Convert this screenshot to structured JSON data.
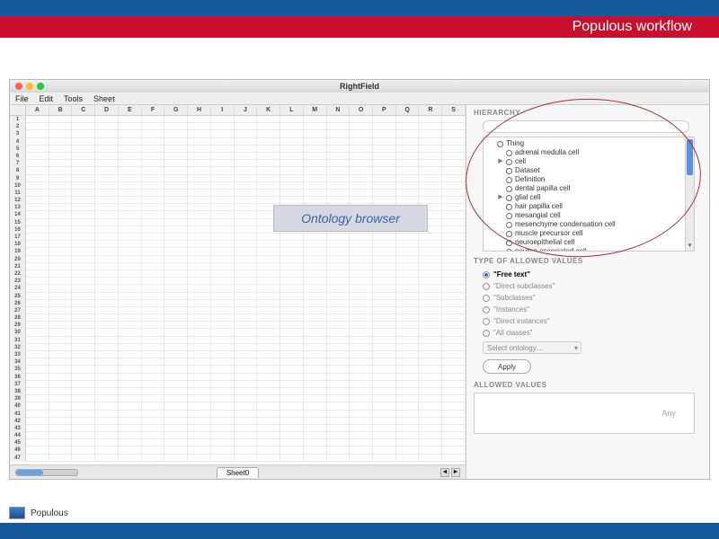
{
  "header": {
    "title": "Populous workflow"
  },
  "window": {
    "title": "RightField",
    "menu": [
      "File",
      "Edit",
      "Tools",
      "Sheet"
    ],
    "columns": [
      "A",
      "B",
      "C",
      "D",
      "E",
      "F",
      "G",
      "H",
      "I",
      "J",
      "K",
      "L",
      "M",
      "N",
      "O",
      "P",
      "Q",
      "R",
      "S"
    ],
    "row_count": 47,
    "sheet_tab": "Sheet0"
  },
  "callout": {
    "label": "Ontology browser"
  },
  "sidepanel": {
    "hierarchy_title": "HIERARCHY",
    "tree": [
      {
        "level": 0,
        "disc": "",
        "label": "Thing"
      },
      {
        "level": 1,
        "disc": "",
        "label": "adrenal medulla cell"
      },
      {
        "level": 1,
        "disc": "▶",
        "label": "cell"
      },
      {
        "level": 1,
        "disc": "",
        "label": "Dataset"
      },
      {
        "level": 1,
        "disc": "",
        "label": "Definition"
      },
      {
        "level": 1,
        "disc": "",
        "label": "dental papilla cell"
      },
      {
        "level": 1,
        "disc": "▶",
        "label": "glial cell"
      },
      {
        "level": 1,
        "disc": "",
        "label": "hair papilla cell"
      },
      {
        "level": 1,
        "disc": "",
        "label": "mesangial cell"
      },
      {
        "level": 1,
        "disc": "",
        "label": "mesenchyme condensation cell"
      },
      {
        "level": 1,
        "disc": "",
        "label": "muscle precursor cell"
      },
      {
        "level": 1,
        "disc": "",
        "label": "neuroepithelial cell"
      },
      {
        "level": 1,
        "disc": "",
        "label": "neuron associated cell"
      }
    ],
    "types_title": "TYPE OF ALLOWED VALUES",
    "types": [
      {
        "label": "\"Free text\"",
        "selected": true
      },
      {
        "label": "\"Direct subclasses\"",
        "selected": false
      },
      {
        "label": "\"Subclasses\"",
        "selected": false
      },
      {
        "label": "\"Instances\"",
        "selected": false
      },
      {
        "label": "\"Direct instances\"",
        "selected": false
      },
      {
        "label": "\"All classes\"",
        "selected": false
      }
    ],
    "select_ontology": "Select ontology…",
    "apply": "Apply",
    "allowed_title": "ALLOWED VALUES",
    "allowed_placeholder": "Any"
  },
  "footer": {
    "label": "Populous"
  }
}
